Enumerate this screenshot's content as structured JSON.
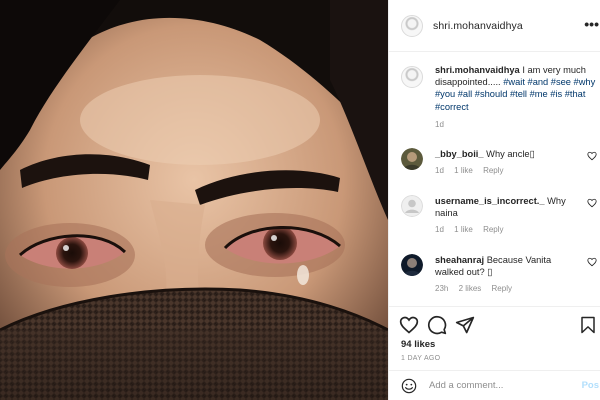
{
  "post": {
    "username": "shri.mohanvaidhya"
  },
  "caption": {
    "username": "shri.mohanvaidhya",
    "text": "I am very much disappointed.....",
    "hashtags": "#wait #and #see #why #you #all #should #tell #me #is #that #correct",
    "time": "1d"
  },
  "comments": [
    {
      "username": "_bby_boii_",
      "text": "Why ancle▯",
      "time": "1d",
      "likes": "1 like",
      "reply": "Reply"
    },
    {
      "username": "username_is_incorrect._",
      "text": "Why naina",
      "time": "1d",
      "likes": "1 like",
      "reply": "Reply"
    },
    {
      "username": "sheahanraj",
      "text": "Because Vanita walked out? ▯",
      "time": "23h",
      "likes": "2 likes",
      "reply": "Reply"
    }
  ],
  "actions": {
    "likes": "94 likes",
    "date": "1 DAY AGO"
  },
  "add_comment": {
    "placeholder": "Add a comment...",
    "post_label": "Pos"
  },
  "colors": {
    "hashtag": "#00376b",
    "muted": "#8e8e8e",
    "post_button": "#b2dffc"
  }
}
